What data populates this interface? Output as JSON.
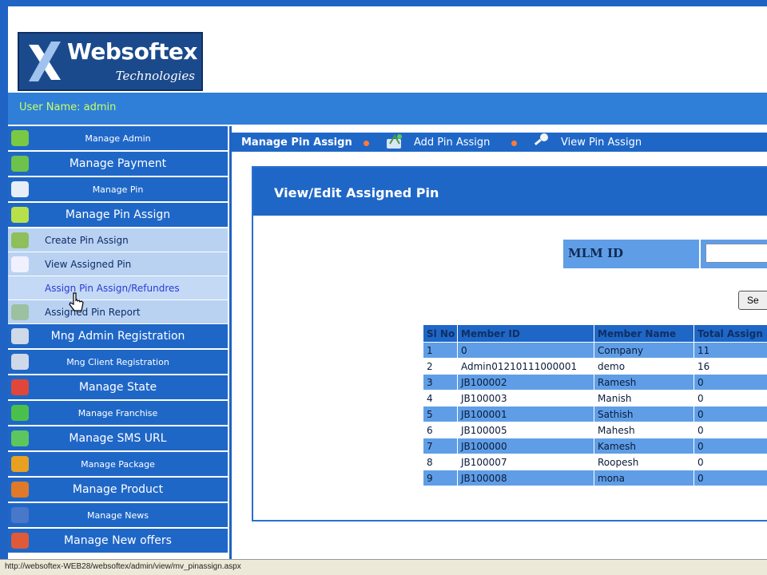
{
  "brand": {
    "name": "Websoftex",
    "tagline": "Technologies"
  },
  "user": {
    "label": "User Name: admin"
  },
  "sidebar": {
    "items": [
      {
        "label": "Manage Admin",
        "type": "main",
        "size": "small",
        "icon_color": "#7ac943"
      },
      {
        "label": "Manage Payment",
        "type": "main",
        "size": "normal",
        "icon_color": "#6cc24a"
      },
      {
        "label": "Manage Pin",
        "type": "main",
        "size": "small",
        "icon_color": "#e8eef7"
      },
      {
        "label": "Manage Pin Assign",
        "type": "main",
        "size": "normal",
        "icon_color": "#b8e04a"
      },
      {
        "label": "Create Pin Assign",
        "type": "sub",
        "icon_color": "#8fbf5a"
      },
      {
        "label": "View Assigned Pin",
        "type": "sub",
        "icon_color": "#f0f0ff"
      },
      {
        "label": "Assign Pin Assign/Refundres",
        "type": "sub",
        "highlight": true,
        "icon_color": "#c4d9f5"
      },
      {
        "label": "Assigned Pin Report",
        "type": "sub",
        "icon_color": "#9bc1a0"
      },
      {
        "label": "Mng Admin Registration",
        "type": "main",
        "size": "normal",
        "icon_color": "#cfd9e8"
      },
      {
        "label": "Mng Client Registration",
        "type": "main",
        "size": "small",
        "icon_color": "#cfd9e8"
      },
      {
        "label": "Manage State",
        "type": "main",
        "size": "normal",
        "icon_color": "#e0473a"
      },
      {
        "label": "Manage Franchise",
        "type": "main",
        "size": "small",
        "icon_color": "#4bbf4b"
      },
      {
        "label": "Manage SMS URL",
        "type": "main",
        "size": "normal",
        "icon_color": "#5ec65e"
      },
      {
        "label": "Manage Package",
        "type": "main",
        "size": "small",
        "icon_color": "#e8a020"
      },
      {
        "label": "Manage Product",
        "type": "main",
        "size": "normal",
        "icon_color": "#e07a2a"
      },
      {
        "label": "Manage News",
        "type": "main",
        "size": "small",
        "icon_color": "#4a78c8"
      },
      {
        "label": "Manage New offers",
        "type": "main",
        "size": "normal",
        "icon_color": "#e05a3a"
      }
    ]
  },
  "tabs": {
    "current": "Manage Pin Assign",
    "add": "Add Pin Assign",
    "view": "View Pin Assign"
  },
  "content": {
    "title": "View/Edit Assigned Pin",
    "mlm_label": "MLM ID",
    "mlm_value": "",
    "search_label": "Se"
  },
  "table": {
    "headers": [
      "Sl No",
      "Member ID",
      "Member Name",
      "Total Assign"
    ],
    "rows": [
      [
        "1",
        "0",
        "Company",
        "11"
      ],
      [
        "2",
        "Admin01210111000001",
        "demo",
        "16"
      ],
      [
        "3",
        "JB100002",
        "Ramesh",
        "0"
      ],
      [
        "4",
        "JB100003",
        "Manish",
        "0"
      ],
      [
        "5",
        "JB100001",
        "Sathish",
        "0"
      ],
      [
        "6",
        "JB100005",
        "Mahesh",
        "0"
      ],
      [
        "7",
        "JB100000",
        "Kamesh",
        "0"
      ],
      [
        "8",
        "JB100007",
        "Roopesh",
        "0"
      ],
      [
        "9",
        "JB100008",
        "mona",
        "0"
      ]
    ]
  },
  "status": {
    "url": "http://websoftex-WEB28/websoftex/admin/view/mv_pinassign.aspx"
  },
  "colors": {
    "accent": "#1f67c7",
    "row_alt": "#5f9ee6",
    "user_text": "#c9ff62"
  }
}
